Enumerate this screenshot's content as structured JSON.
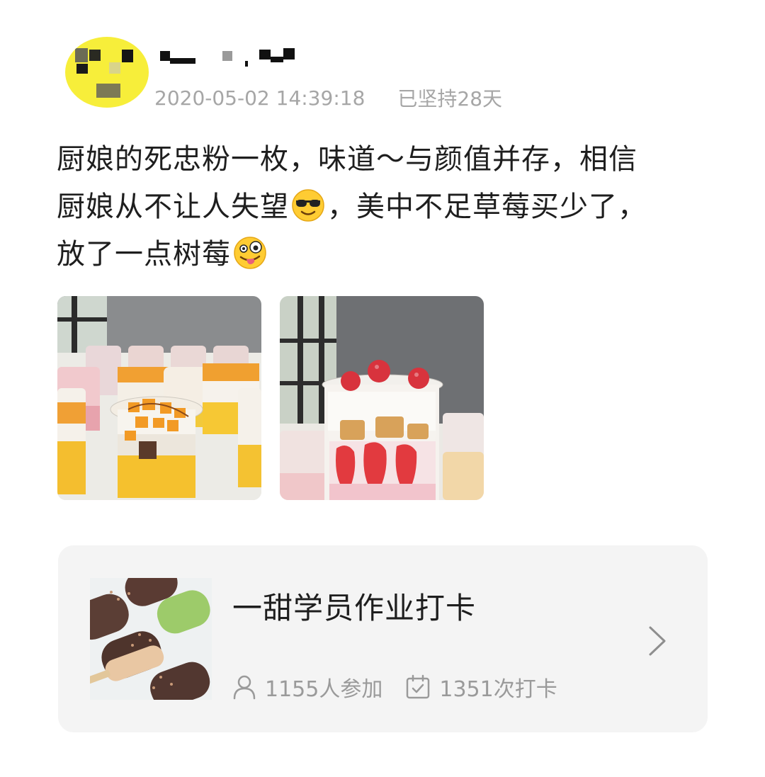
{
  "post": {
    "timestamp": "2020-05-02 14:39:18",
    "streak": "已坚持28天",
    "text_line1": "厨娘的死忠粉一枚，味道～与颜值并存，相信",
    "text_line2a": "厨娘从不让人失望",
    "text_line2b": "，美中不足草莓买少了，",
    "text_line3": "放了一点树莓",
    "emoji_1": "smiling-face-with-sunglasses",
    "emoji_2": "zany-face",
    "photos": [
      "mango-cup-desserts",
      "strawberry-cup-dessert"
    ]
  },
  "card": {
    "title": "一甜学员作业打卡",
    "participants": "1155人参加",
    "checkins": "1351次打卡",
    "thumb": "ice-cream-bars"
  },
  "colors": {
    "meta_gray": "#a6a6a6",
    "card_bg": "#f4f4f4",
    "avatar_yellow": "#f7ee3a"
  }
}
